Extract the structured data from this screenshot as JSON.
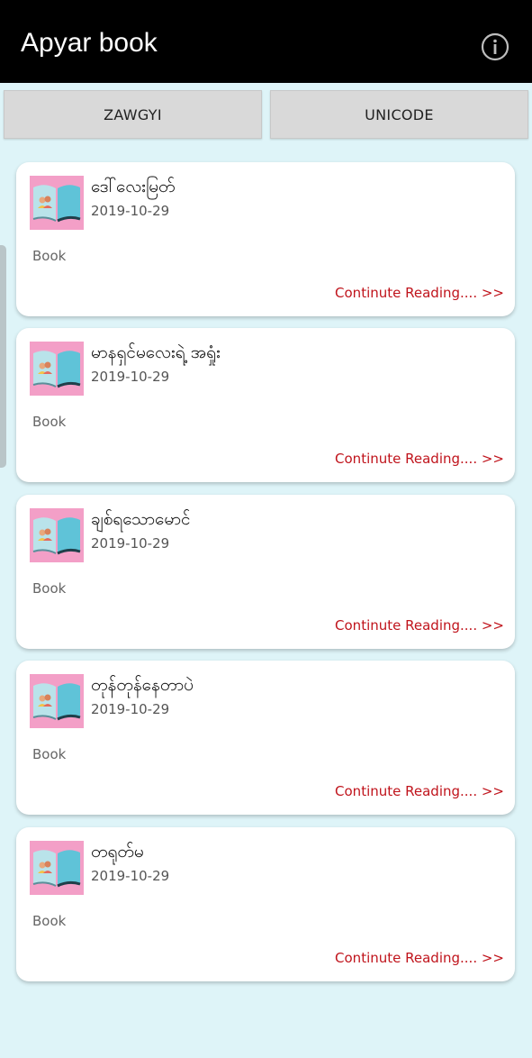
{
  "appbar": {
    "title": "Apyar book",
    "info_icon": "info-circle-icon"
  },
  "tabs": [
    {
      "label": "ZAWGYI"
    },
    {
      "label": "UNICODE"
    }
  ],
  "books": [
    {
      "title": "ဒေါ်လေးမြတ်",
      "date": "2019-10-29",
      "category": "Book",
      "link": "Continute Reading.... >>"
    },
    {
      "title": "မာနရှင်မလေးရဲ့ အရှုံး",
      "date": "2019-10-29",
      "category": "Book",
      "link": "Continute Reading.... >>"
    },
    {
      "title": "ချစ်ရသောမောင်",
      "date": "2019-10-29",
      "category": "Book",
      "link": "Continute Reading.... >>"
    },
    {
      "title": "တုန်တုန်နေတာပဲ",
      "date": "2019-10-29",
      "category": "Book",
      "link": "Continute Reading.... >>"
    },
    {
      "title": "တရုတ်မ",
      "date": "2019-10-29",
      "category": "Book",
      "link": "Continute Reading.... >>"
    }
  ],
  "colors": {
    "background": "#def4f8",
    "appbar": "#000000",
    "link": "#c0141c",
    "thumb": "#f39fc7"
  }
}
